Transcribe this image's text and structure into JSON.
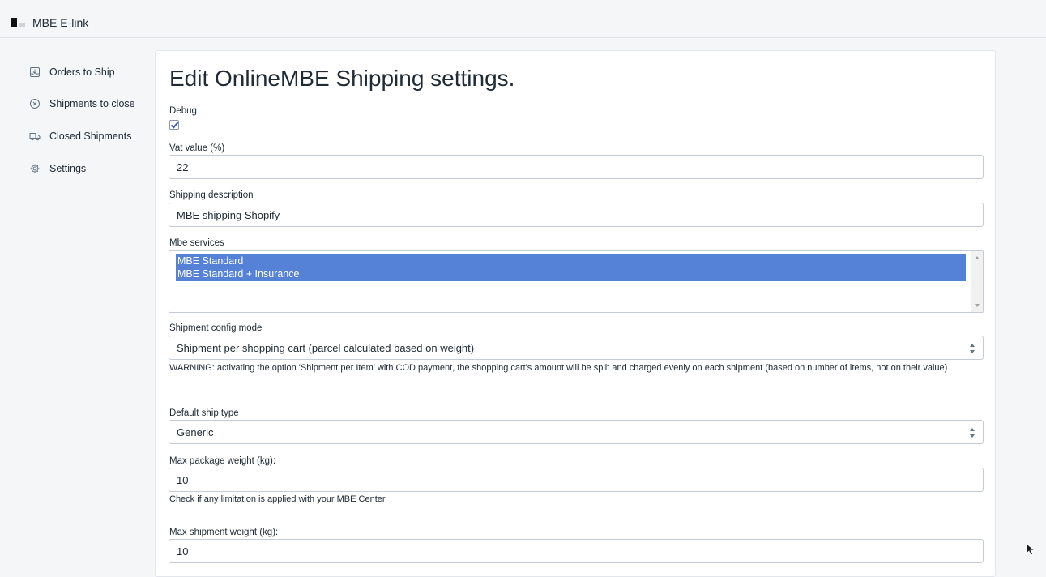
{
  "header": {
    "app_title": "MBE E-link",
    "logo_icon": "mbe-logo-icon"
  },
  "sidebar": {
    "items": [
      {
        "label": "Orders to Ship",
        "icon": "inbox-download-icon"
      },
      {
        "label": "Shipments to close",
        "icon": "circle-x-icon"
      },
      {
        "label": "Closed Shipments",
        "icon": "truck-icon"
      },
      {
        "label": "Settings",
        "icon": "gear-icon"
      }
    ]
  },
  "form": {
    "title": "Edit OnlineMBE Shipping settings.",
    "debug": {
      "label": "Debug",
      "checked": true
    },
    "vat": {
      "label": "Vat value (%)",
      "value": "22"
    },
    "shipping_description": {
      "label": "Shipping description",
      "value": "MBE shipping Shopify"
    },
    "mbe_services": {
      "label": "Mbe services",
      "options": [
        {
          "label": "MBE Standard",
          "selected": true
        },
        {
          "label": "MBE Standard + Insurance",
          "selected": true
        }
      ]
    },
    "shipment_config_mode": {
      "label": "Shipment config mode",
      "value": "Shipment per shopping cart (parcel calculated based on weight)",
      "warning": "WARNING: activating the option 'Shipment per Item' with COD payment, the shopping cart's amount will be split and charged evenly on each shipment (based on number of items, not on their value)"
    },
    "default_ship_type": {
      "label": "Default ship type",
      "value": "Generic"
    },
    "max_package_weight": {
      "label": "Max package weight (kg):",
      "value": "10",
      "help": "Check if any limitation is applied with your MBE Center"
    },
    "max_shipment_weight": {
      "label": "Max shipment weight (kg):",
      "value": "10"
    }
  },
  "colors": {
    "selected_option": "#5581d6",
    "page_background": "#f4f6f8",
    "card_background": "#ffffff"
  }
}
